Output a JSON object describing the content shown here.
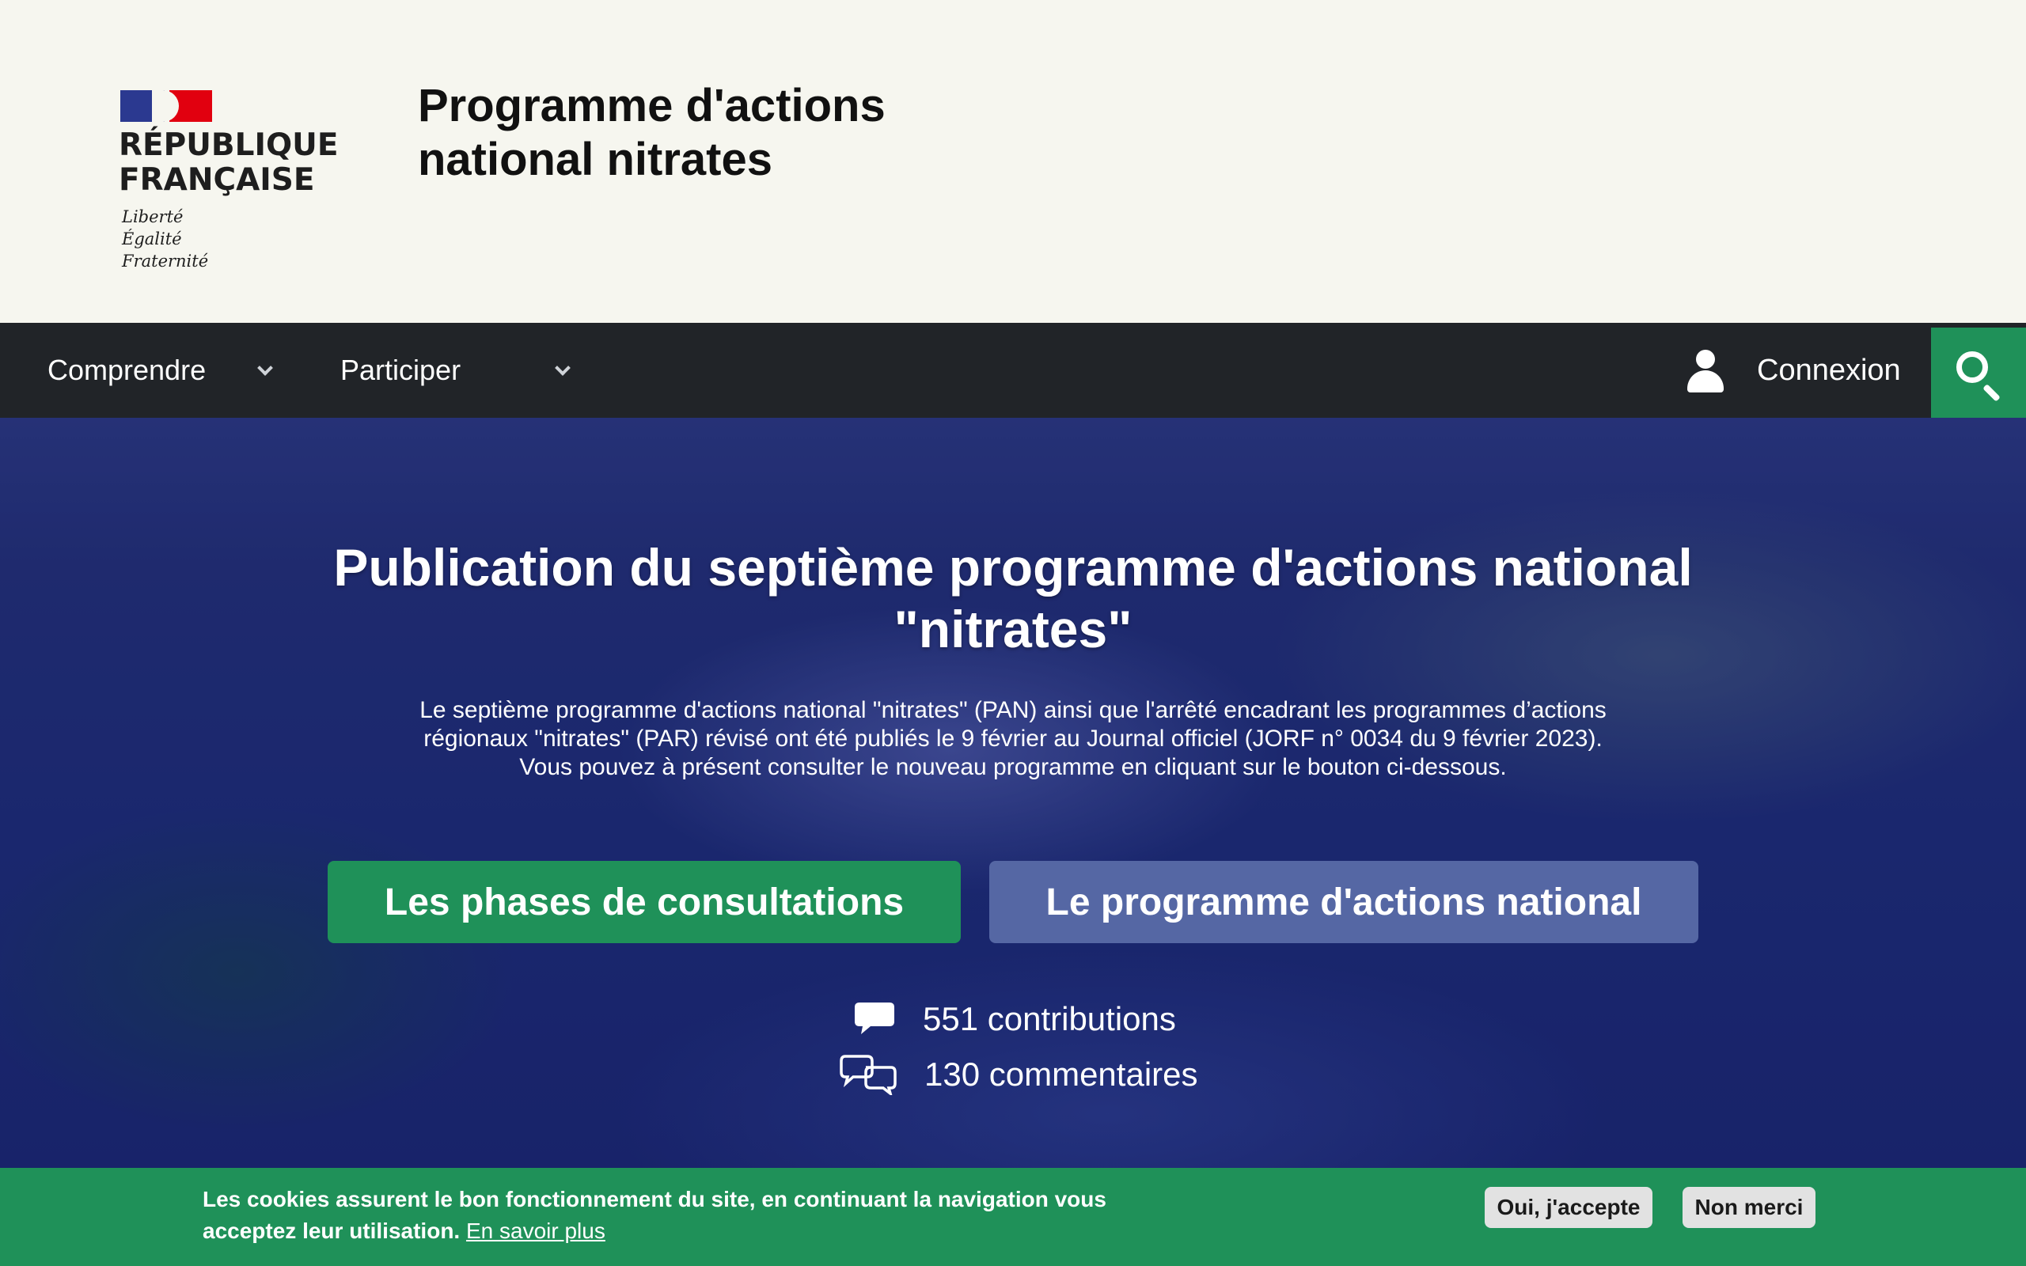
{
  "header": {
    "logo_lines": [
      "RÉPUBLIQUE",
      "FRANÇAISE"
    ],
    "motto": [
      "Liberté",
      "Égalité",
      "Fraternité"
    ],
    "site_title": "Programme d'actions national nitrates"
  },
  "nav": {
    "items": [
      {
        "label": "Comprendre",
        "icon": "chevron-down-icon"
      },
      {
        "label": "Participer",
        "icon": "chevron-down-icon"
      }
    ],
    "login_label": "Connexion",
    "login_icon": "user-icon",
    "search_icon": "search-icon",
    "accent_color": "#1f9159",
    "background_color": "#212428"
  },
  "hero": {
    "title": "Publication du septième programme d'actions national \"nitrates\"",
    "text_1": "Le septième programme d'actions national \"nitrates\" (PAN) ainsi que l'arrêté encadrant les programmes d’actions régionaux \"nitrates\" (PAR) révisé ont été publiés le 9 février au Journal officiel (JORF n° 0034 du 9 février 2023).",
    "text_2": "Vous pouvez à présent consulter le nouveau programme en cliquant sur le bouton ci-dessous.",
    "buttons": {
      "consultations": "Les phases de consultations",
      "programme": "Le programme d'actions national"
    },
    "stats": {
      "contributions": "551 contributions",
      "contributions_icon": "speech-bubble-icon",
      "comments": "130 commentaires",
      "comments_icon": "conversation-icon"
    },
    "colors": {
      "green_button": "#1f9159",
      "blue_button": "#5567a4"
    }
  },
  "cookie_banner": {
    "text": "Les cookies assurent le bon fonctionnement du site, en continuant la navigation vous acceptez leur utilisation.",
    "link": "En savoir plus",
    "accept": "Oui, j'accepte",
    "refuse": "Non merci"
  }
}
